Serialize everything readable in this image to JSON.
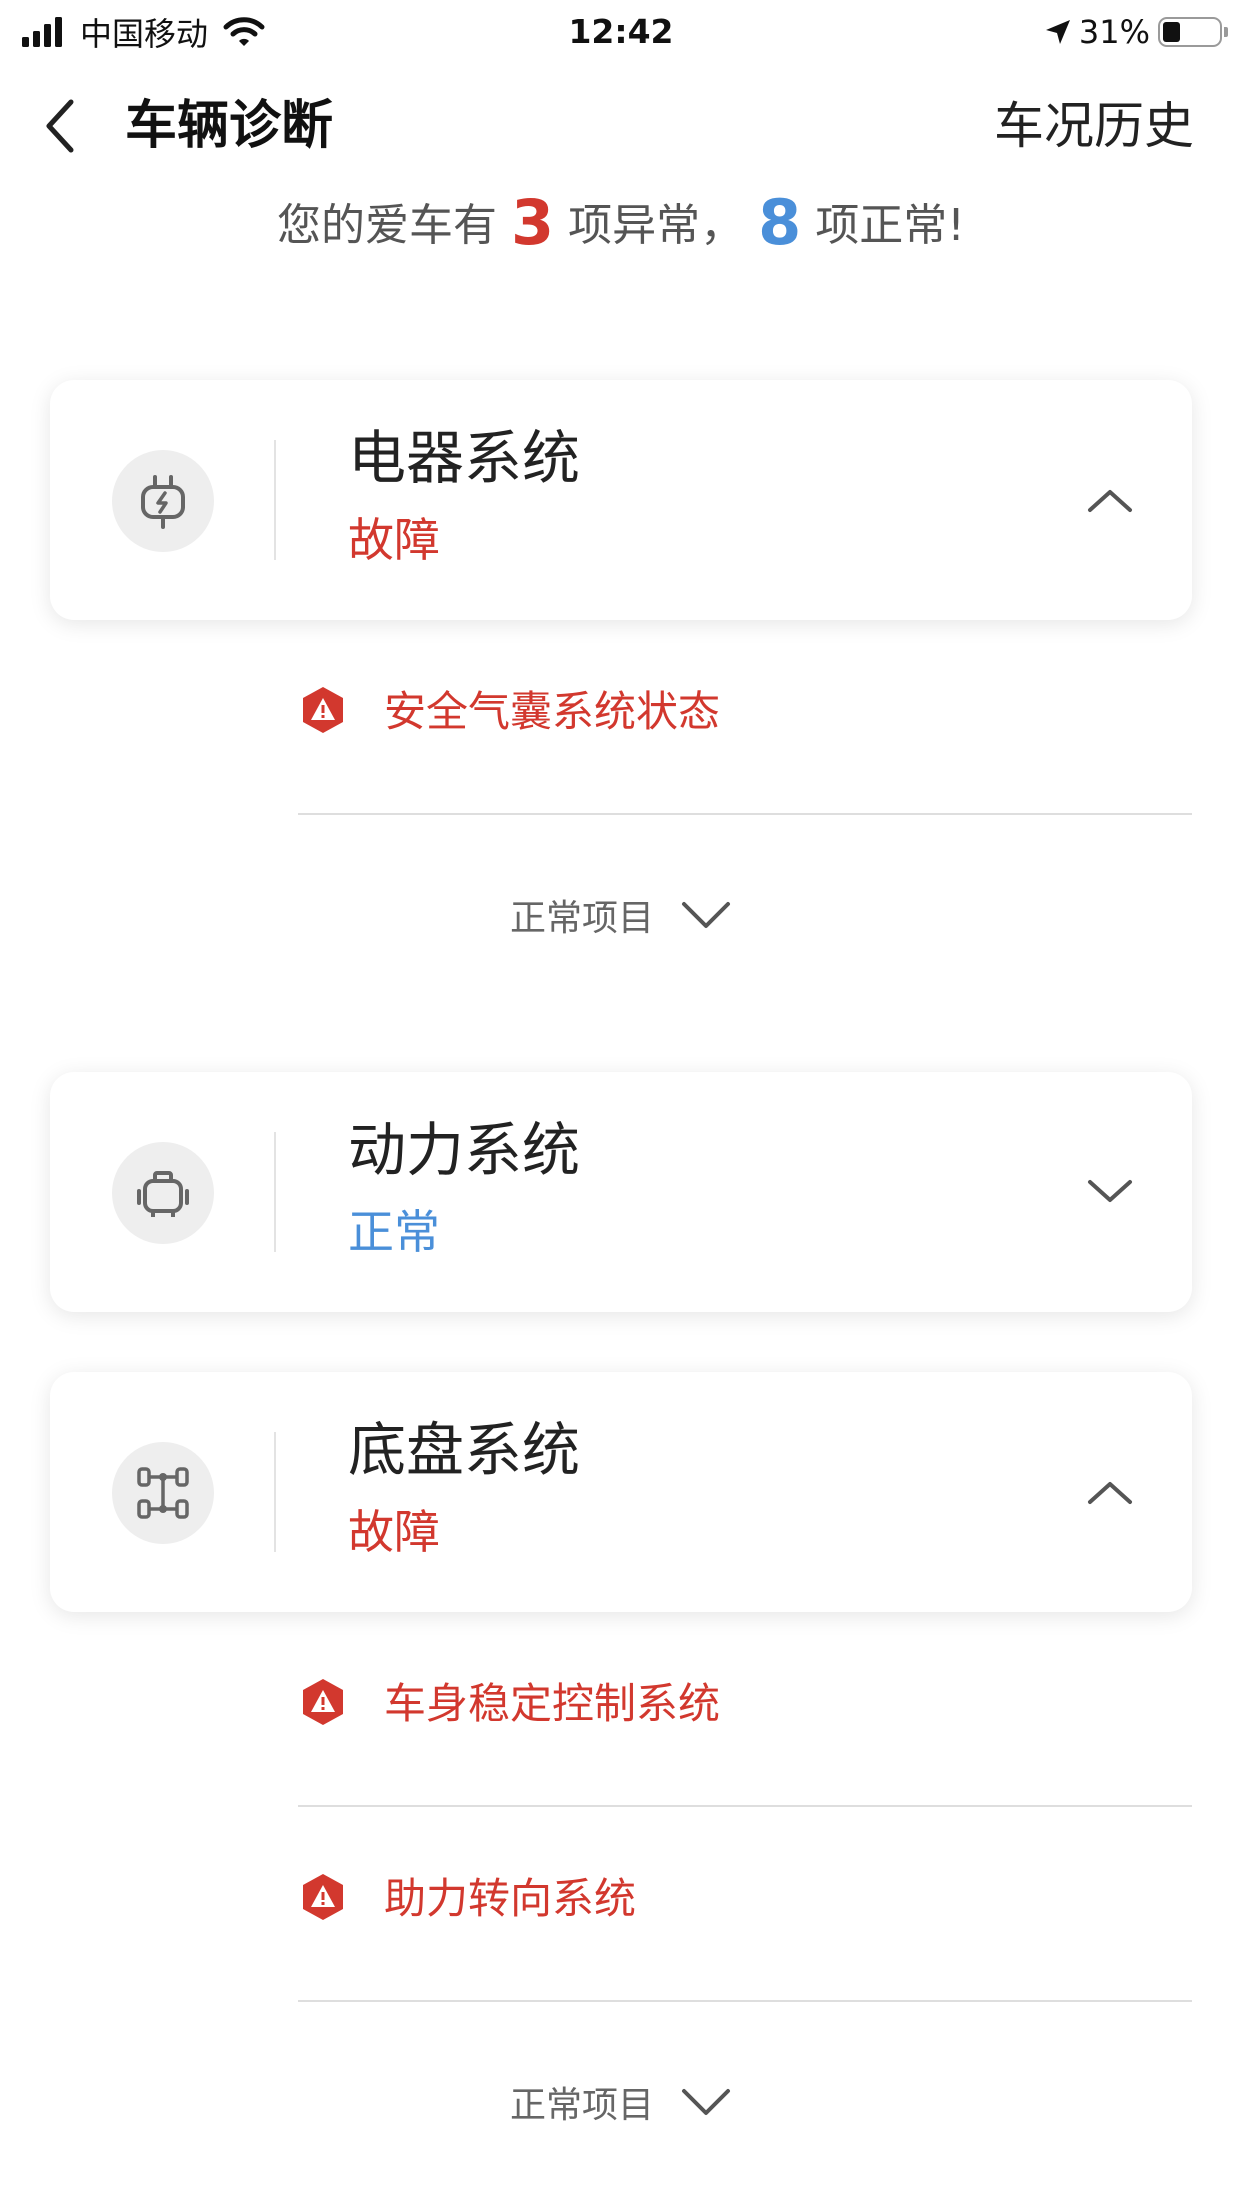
{
  "status_bar": {
    "carrier": "中国移动",
    "time": "12:42",
    "battery": "31%",
    "battery_level": 0.31
  },
  "nav": {
    "title": "车辆诊断",
    "history": "车况历史"
  },
  "summary": {
    "prefix": "您的爱车有",
    "abnormal_count": "3",
    "middle": "项异常，",
    "normal_count": "8",
    "suffix": "项正常!"
  },
  "systems": [
    {
      "name": "电器系统",
      "status": "故障",
      "icon": "electrical-plug-icon",
      "expanded": true,
      "faults": [
        "安全气囊系统状态"
      ],
      "normal_toggle": "正常项目"
    },
    {
      "name": "动力系统",
      "status": "正常",
      "icon": "engine-icon",
      "expanded": false
    },
    {
      "name": "底盘系统",
      "status": "故障",
      "icon": "chassis-icon",
      "expanded": true,
      "faults": [
        "车身稳定控制系统",
        "助力转向系统"
      ],
      "normal_toggle": "正常项目"
    }
  ],
  "colors": {
    "fault_red": "#d2382e",
    "normal_blue": "#4a8fd9"
  }
}
